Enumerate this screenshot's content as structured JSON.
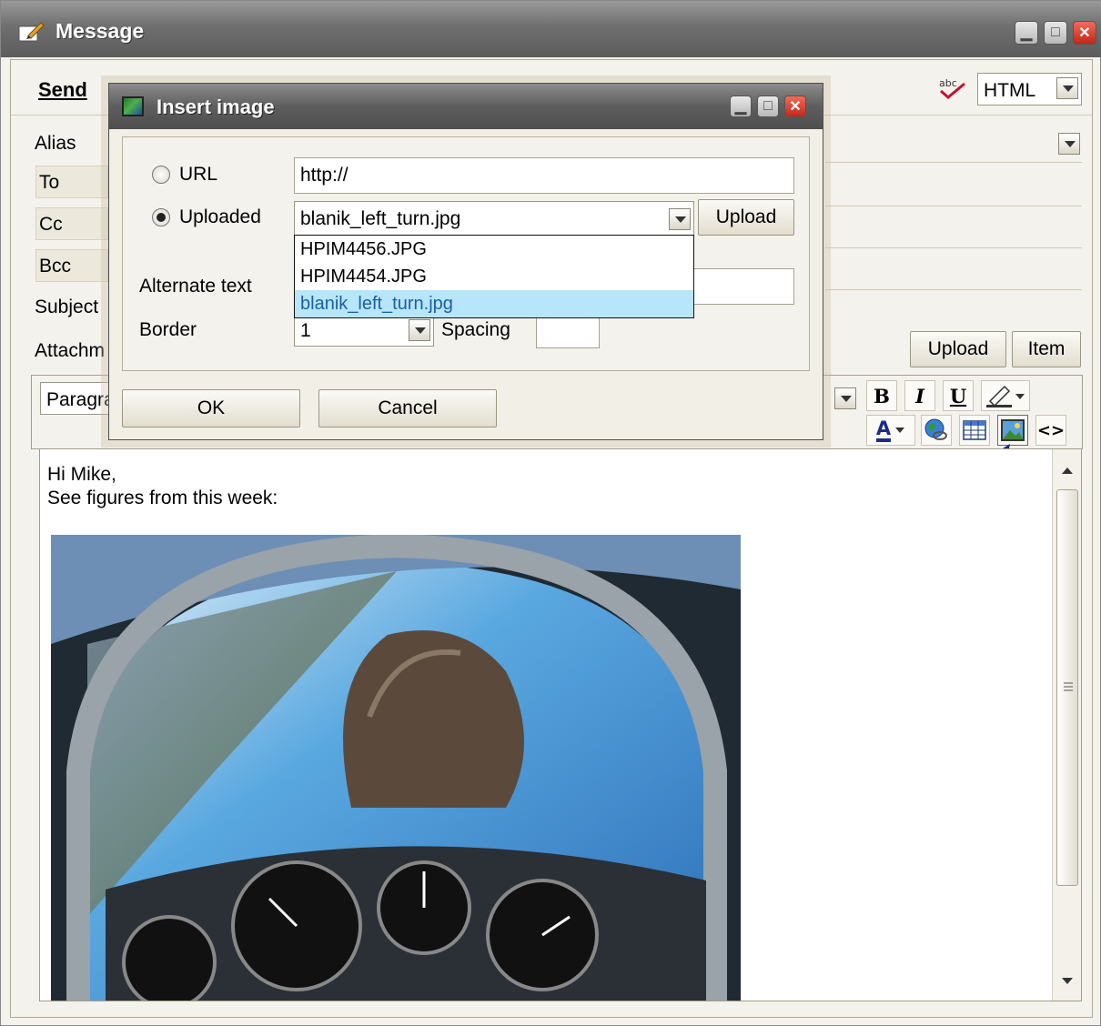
{
  "window": {
    "title": "Message",
    "controls": [
      "minimize",
      "maximize",
      "close"
    ]
  },
  "compose": {
    "send_label": "Send",
    "spellcheck_icon": "spellcheck-icon",
    "format_value": "HTML",
    "fields": {
      "alias_label": "Alias",
      "to_label": "To",
      "cc_label": "Cc",
      "bcc_label": "Bcc",
      "subject_label": "Subject",
      "attachments_label": "Attachm"
    },
    "upload_label": "Upload",
    "item_label": "Item"
  },
  "editor_toolbar": {
    "paragraph_value": "Paragra",
    "bold_label": "B",
    "italic_label": "I",
    "underline_label": "U",
    "text_color_label": "A",
    "source_label": "<>"
  },
  "editor": {
    "line1": "Hi Mike,",
    "line2": "See figures from this week:",
    "image_description": "glider cockpit photo"
  },
  "dialog": {
    "title": "Insert image",
    "url_label": "URL",
    "url_value": "http://",
    "uploaded_label": "Uploaded",
    "uploaded_value": "blanik_left_turn.jpg",
    "upload_button": "Upload",
    "alt_text_label": "Alternate text",
    "border_label": "Border",
    "border_value": "1",
    "spacing_label": "Spacing",
    "spacing_value": "",
    "ok_label": "OK",
    "cancel_label": "Cancel",
    "dropdown_options": [
      "HPIM4456.JPG",
      "HPIM4454.JPG",
      "blanik_left_turn.jpg"
    ],
    "selected_option_index": 2
  },
  "colors": {
    "window_bg": "#f4f2ec",
    "title_bar": "#6f6f6f",
    "selection": "#b7e6fa",
    "selection_text": "#1c5fa6",
    "arrow": "#1a237e"
  }
}
